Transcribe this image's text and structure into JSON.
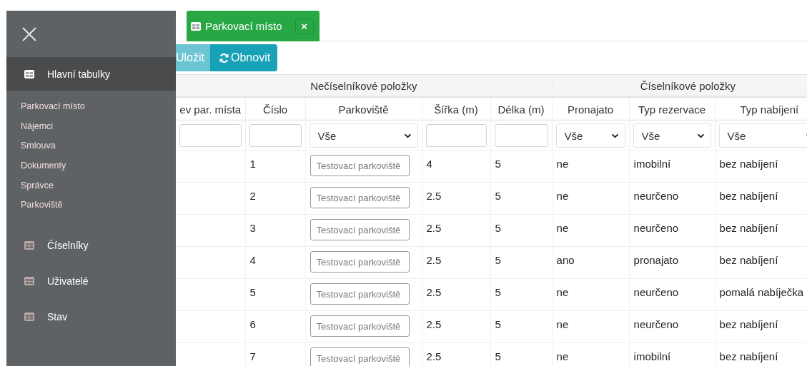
{
  "sidebar": {
    "sections": [
      {
        "label": "Hlavní tabulky",
        "selected": true,
        "children": [
          "Parkovací místo",
          "Nájemci",
          "Smlouva",
          "Dokumenty",
          "Správce",
          "Parkoviště"
        ]
      },
      {
        "label": "Číselníky",
        "selected": false
      },
      {
        "label": "Uživatelé",
        "selected": false
      },
      {
        "label": "Stav",
        "selected": false
      }
    ]
  },
  "tabs": [
    {
      "label": "Parkovací místo",
      "selected": true,
      "close": "×"
    }
  ],
  "buttons": [
    {
      "label": "Uložit",
      "kind": "save",
      "disabled": true
    },
    {
      "label": "Obnovit",
      "kind": "refresh",
      "disabled": false
    }
  ],
  "table": {
    "groups": [
      {
        "label": "Nečíselníkové položky"
      },
      {
        "label": "Číselníkové položky"
      }
    ],
    "columns": [
      {
        "label": "ev par. místa",
        "kind": "text"
      },
      {
        "label": "Číslo",
        "kind": "text"
      },
      {
        "label": "Parkoviště",
        "kind": "select",
        "filter_value": "Vše"
      },
      {
        "label": "Šířka (m)",
        "kind": "text"
      },
      {
        "label": "Délka (m)",
        "kind": "text"
      },
      {
        "label": "Pronajato",
        "kind": "select",
        "filter_value": "Vše"
      },
      {
        "label": "Typ rezervace",
        "kind": "select",
        "filter_value": "Vše"
      },
      {
        "label": "Typ nabíjení",
        "kind": "select",
        "filter_value": "Vše"
      }
    ],
    "rows": [
      {
        "cislo": "1",
        "parkoviste": "Testovací parkoviště",
        "sirka": "4",
        "delka": "5",
        "pronajato": "ne",
        "typ_rezervace": "imobilní",
        "typ_nabijeni": "bez nabíjení"
      },
      {
        "cislo": "2",
        "parkoviste": "Testovací parkoviště",
        "sirka": "2.5",
        "delka": "5",
        "pronajato": "ne",
        "typ_rezervace": "neurčeno",
        "typ_nabijeni": "bez nabíjení"
      },
      {
        "cislo": "3",
        "parkoviste": "Testovací parkoviště",
        "sirka": "2.5",
        "delka": "5",
        "pronajato": "ne",
        "typ_rezervace": "neurčeno",
        "typ_nabijeni": "bez nabíjení"
      },
      {
        "cislo": "4",
        "parkoviste": "Testovací parkoviště",
        "sirka": "2.5",
        "delka": "5",
        "pronajato": "ano",
        "typ_rezervace": "pronajato",
        "typ_nabijeni": "bez nabíjení"
      },
      {
        "cislo": "5",
        "parkoviste": "Testovací parkoviště",
        "sirka": "2.5",
        "delka": "5",
        "pronajato": "ne",
        "typ_rezervace": "neurčeno",
        "typ_nabijeni": "pomalá nabíječka"
      },
      {
        "cislo": "6",
        "parkoviste": "Testovací parkoviště",
        "sirka": "2.5",
        "delka": "5",
        "pronajato": "ne",
        "typ_rezervace": "neurčeno",
        "typ_nabijeni": "bez nabíjení"
      },
      {
        "cislo": "7",
        "parkoviste": "Testovací parkoviště",
        "sirka": "2.5",
        "delka": "5",
        "pronajato": "ne",
        "typ_rezervace": "imobilní",
        "typ_nabijeni": "bez nabíjení"
      }
    ]
  }
}
